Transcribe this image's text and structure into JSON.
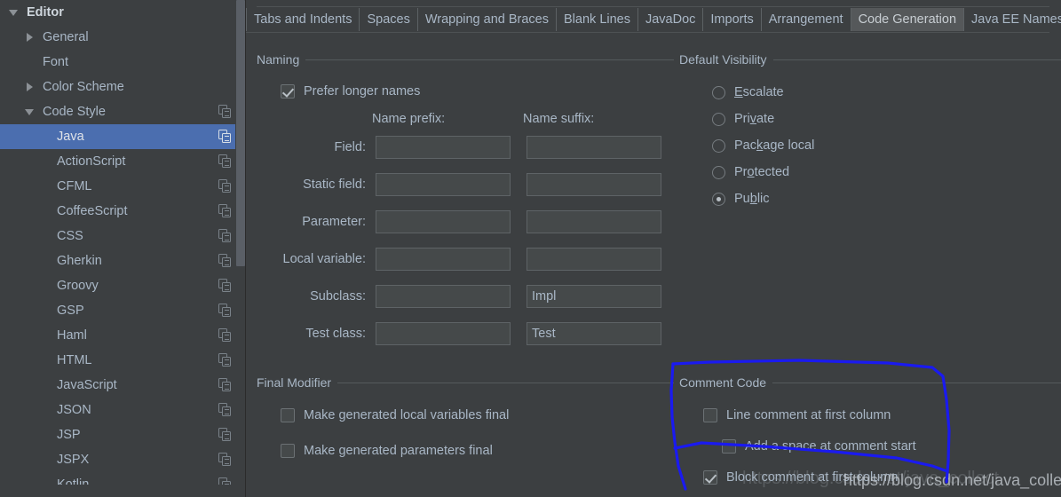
{
  "sidebar": {
    "scrollbar": {
      "name": "tree-scrollbar"
    },
    "items": [
      {
        "label": "Editor",
        "indent": 0,
        "twisty": "open",
        "copy": false,
        "selected": false,
        "root": true
      },
      {
        "label": "General",
        "indent": 1,
        "twisty": "closed",
        "copy": false,
        "selected": false,
        "root": false
      },
      {
        "label": "Font",
        "indent": 1,
        "twisty": "none",
        "copy": false,
        "selected": false,
        "root": false
      },
      {
        "label": "Color Scheme",
        "indent": 1,
        "twisty": "closed",
        "copy": false,
        "selected": false,
        "root": false
      },
      {
        "label": "Code Style",
        "indent": 1,
        "twisty": "open",
        "copy": true,
        "selected": false,
        "root": false
      },
      {
        "label": "Java",
        "indent": 2,
        "twisty": "none",
        "copy": true,
        "selected": true,
        "root": false
      },
      {
        "label": "ActionScript",
        "indent": 2,
        "twisty": "none",
        "copy": true,
        "selected": false,
        "root": false
      },
      {
        "label": "CFML",
        "indent": 2,
        "twisty": "none",
        "copy": true,
        "selected": false,
        "root": false
      },
      {
        "label": "CoffeeScript",
        "indent": 2,
        "twisty": "none",
        "copy": true,
        "selected": false,
        "root": false
      },
      {
        "label": "CSS",
        "indent": 2,
        "twisty": "none",
        "copy": true,
        "selected": false,
        "root": false
      },
      {
        "label": "Gherkin",
        "indent": 2,
        "twisty": "none",
        "copy": true,
        "selected": false,
        "root": false
      },
      {
        "label": "Groovy",
        "indent": 2,
        "twisty": "none",
        "copy": true,
        "selected": false,
        "root": false
      },
      {
        "label": "GSP",
        "indent": 2,
        "twisty": "none",
        "copy": true,
        "selected": false,
        "root": false
      },
      {
        "label": "Haml",
        "indent": 2,
        "twisty": "none",
        "copy": true,
        "selected": false,
        "root": false
      },
      {
        "label": "HTML",
        "indent": 2,
        "twisty": "none",
        "copy": true,
        "selected": false,
        "root": false
      },
      {
        "label": "JavaScript",
        "indent": 2,
        "twisty": "none",
        "copy": true,
        "selected": false,
        "root": false
      },
      {
        "label": "JSON",
        "indent": 2,
        "twisty": "none",
        "copy": true,
        "selected": false,
        "root": false
      },
      {
        "label": "JSP",
        "indent": 2,
        "twisty": "none",
        "copy": true,
        "selected": false,
        "root": false
      },
      {
        "label": "JSPX",
        "indent": 2,
        "twisty": "none",
        "copy": true,
        "selected": false,
        "root": false
      },
      {
        "label": "Kotlin",
        "indent": 2,
        "twisty": "none",
        "copy": true,
        "selected": false,
        "root": false
      }
    ]
  },
  "tabs": [
    {
      "label": "Tabs and Indents",
      "active": false
    },
    {
      "label": "Spaces",
      "active": false
    },
    {
      "label": "Wrapping and Braces",
      "active": false
    },
    {
      "label": "Blank Lines",
      "active": false
    },
    {
      "label": "JavaDoc",
      "active": false
    },
    {
      "label": "Imports",
      "active": false
    },
    {
      "label": "Arrangement",
      "active": false
    },
    {
      "label": "Code Generation",
      "active": true
    },
    {
      "label": "Java EE Names",
      "active": false
    }
  ],
  "naming": {
    "title": "Naming",
    "prefer_longer_names": {
      "label": "Prefer longer names",
      "checked": true
    },
    "col_prefix": "Name prefix:",
    "col_suffix": "Name suffix:",
    "rows": [
      {
        "label": "Field:",
        "prefix": "",
        "suffix": ""
      },
      {
        "label": "Static field:",
        "prefix": "",
        "suffix": ""
      },
      {
        "label": "Parameter:",
        "prefix": "",
        "suffix": ""
      },
      {
        "label": "Local variable:",
        "prefix": "",
        "suffix": ""
      },
      {
        "label": "Subclass:",
        "prefix": "",
        "suffix": "Impl"
      },
      {
        "label": "Test class:",
        "prefix": "",
        "suffix": "Test"
      }
    ]
  },
  "default_visibility": {
    "title": "Default Visibility",
    "options": [
      {
        "label": "Escalate",
        "mnemonic": "E",
        "selected": false
      },
      {
        "label": "Private",
        "mnemonic": "v",
        "selected": false
      },
      {
        "label": "Package local",
        "mnemonic": "k",
        "selected": false
      },
      {
        "label": "Protected",
        "mnemonic": "o",
        "selected": false
      },
      {
        "label": "Public",
        "mnemonic": "b",
        "selected": true
      }
    ]
  },
  "final_modifier": {
    "title": "Final Modifier",
    "options": [
      {
        "label": "Make generated local variables final",
        "checked": false
      },
      {
        "label": "Make generated parameters final",
        "checked": false
      }
    ]
  },
  "comment_code": {
    "title": "Comment Code",
    "options": [
      {
        "label": "Line comment at first column",
        "checked": false,
        "indent": 0
      },
      {
        "label": "Add a space at comment start",
        "checked": false,
        "indent": 1
      },
      {
        "label": "Block comment at first column",
        "checked": true,
        "indent": 0
      }
    ]
  },
  "annotation": {
    "color": "#1a1af0",
    "shape": "hand-drawn-rounded-rectangle"
  },
  "watermark": {
    "main": "https://blog.csdn.net/java_collect",
    "ghost": "https://blog.csdn.net/java_collect"
  }
}
